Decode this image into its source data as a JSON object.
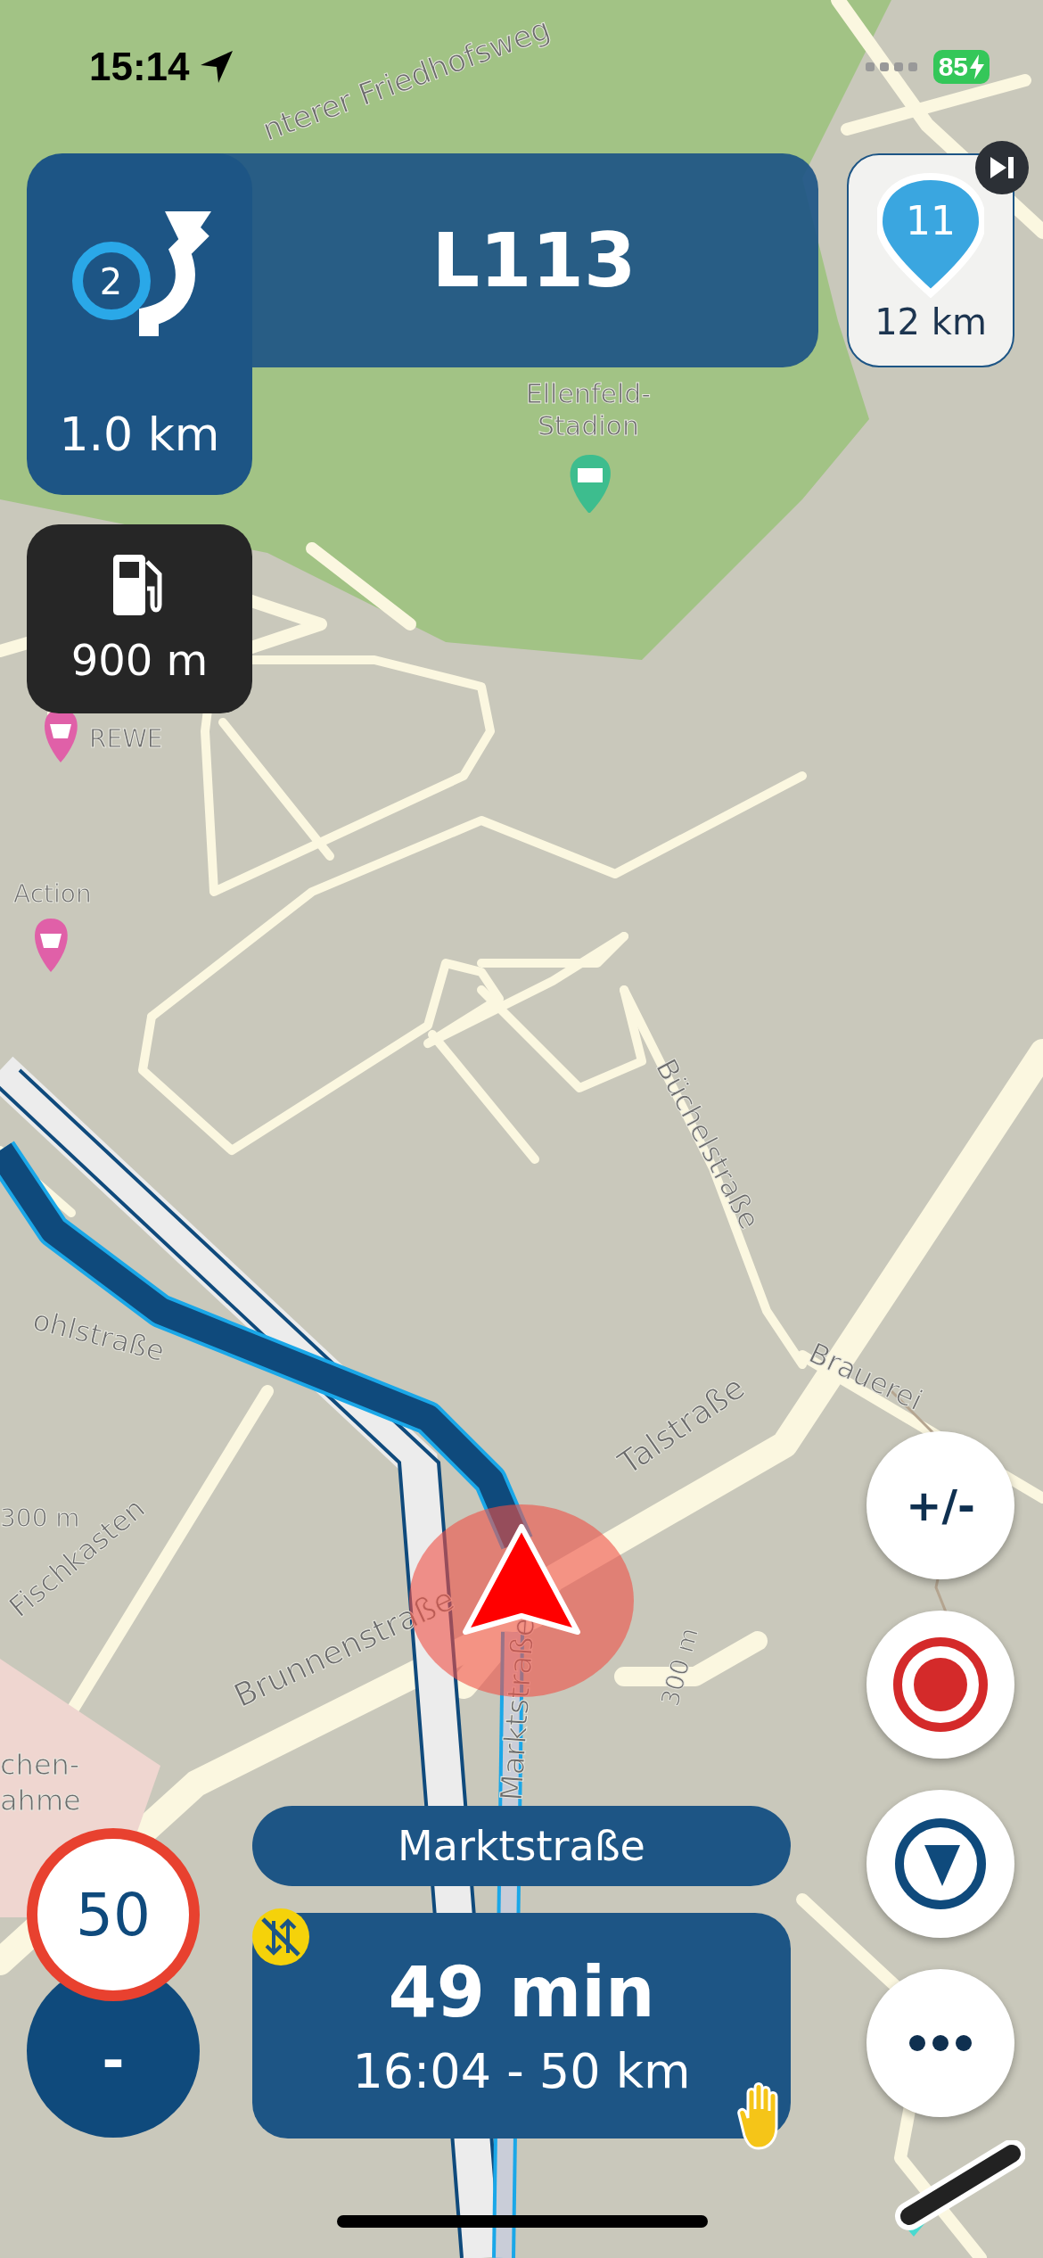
{
  "status_bar": {
    "time": "15:14",
    "battery": "85"
  },
  "maneuver": {
    "exit": "2",
    "distance": "1.0 km",
    "road": "L113"
  },
  "next_stop": {
    "number": "11",
    "distance": "12 km"
  },
  "fuel": {
    "distance": "900 m"
  },
  "map": {
    "labels": [
      {
        "text": "nterer Friedhofsweg"
      },
      {
        "text": "Ellenfeld-"
      },
      {
        "text": "Stadion"
      },
      {
        "text": "REWE"
      },
      {
        "text": "Action"
      },
      {
        "text": "Büchelstraße"
      },
      {
        "text": "Talstraße"
      },
      {
        "text": "Brauerei"
      },
      {
        "text": "Brunnenstraße"
      },
      {
        "text": "Fischkasten"
      },
      {
        "text": "Marktstraße"
      },
      {
        "text": "ohlstraße"
      },
      {
        "text": "300 m"
      },
      {
        "text": "300 m"
      },
      {
        "text": "chen-"
      },
      {
        "text": "ahme"
      }
    ]
  },
  "speed": {
    "limit": "50",
    "current": "-"
  },
  "street": "Marktstraße",
  "eta": {
    "duration": "49 min",
    "arrival": "16:04 - 50 km"
  },
  "buttons": [
    {
      "kind": "zoom",
      "label": "+/-"
    },
    {
      "kind": "record"
    },
    {
      "kind": "compass"
    },
    {
      "kind": "more"
    }
  ]
}
